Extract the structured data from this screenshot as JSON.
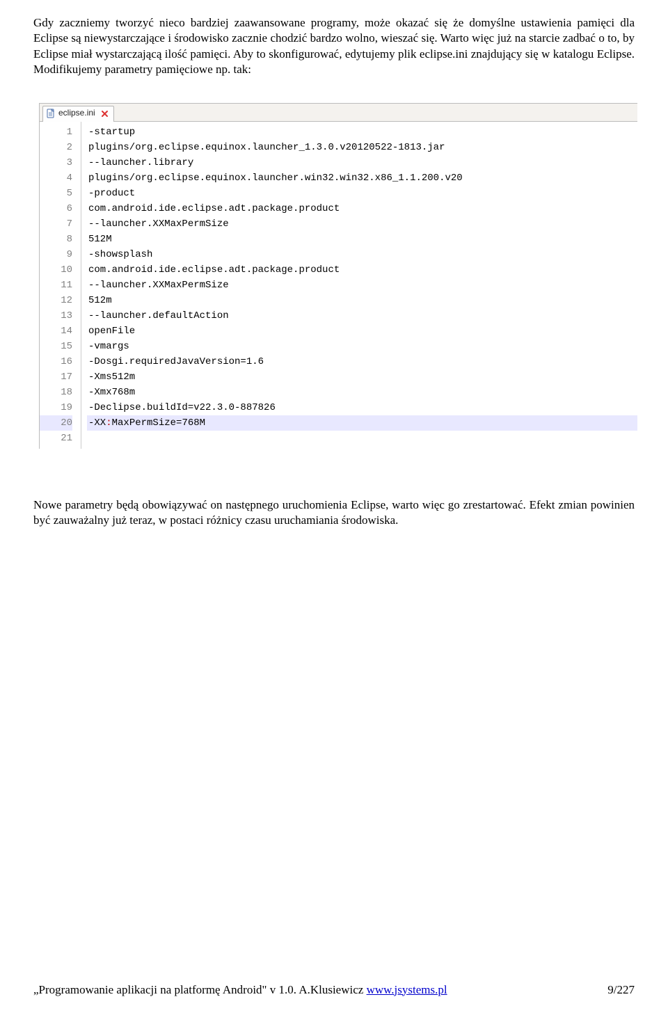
{
  "para1": "Gdy zaczniemy tworzyć nieco bardziej zaawansowane programy, może okazać się że domyślne ustawienia pamięci dla Eclipse są niewystarczające i środowisko zacznie chodzić bardzo wolno, wieszać się. Warto więc już na starcie zadbać o to, by Eclipse miał wystarczającą ilość pamięci. Aby to skonfigurować, edytujemy plik eclipse.ini znajdujący się w katalogu Eclipse. Modifikujemy parametry pamięciowe np. tak:",
  "editor": {
    "tab": {
      "filename": "eclipse.ini",
      "icon": "file-icon",
      "close": "close-icon"
    },
    "currentLine": 20,
    "lines": [
      {
        "n": 1,
        "text": "-startup"
      },
      {
        "n": 2,
        "text": "plugins/org.eclipse.equinox.launcher_1.3.0.v20120522-1813.jar"
      },
      {
        "n": 3,
        "text": "--launcher.library"
      },
      {
        "n": 4,
        "text": "plugins/org.eclipse.equinox.launcher.win32.win32.x86_1.1.200.v20"
      },
      {
        "n": 5,
        "text": "-product"
      },
      {
        "n": 6,
        "text": "com.android.ide.eclipse.adt.package.product"
      },
      {
        "n": 7,
        "text": "--launcher.XXMaxPermSize"
      },
      {
        "n": 8,
        "text": "512M"
      },
      {
        "n": 9,
        "text": "-showsplash"
      },
      {
        "n": 10,
        "text": "com.android.ide.eclipse.adt.package.product"
      },
      {
        "n": 11,
        "text": "--launcher.XXMaxPermSize"
      },
      {
        "n": 12,
        "text": "512m"
      },
      {
        "n": 13,
        "text": "--launcher.defaultAction"
      },
      {
        "n": 14,
        "text": "openFile"
      },
      {
        "n": 15,
        "text": "-vmargs"
      },
      {
        "n": 16,
        "text": "-Dosgi.requiredJavaVersion=1.6"
      },
      {
        "n": 17,
        "text": "-Xms512m"
      },
      {
        "n": 18,
        "text": "-Xmx768m"
      },
      {
        "n": 19,
        "text": "-Declipse.buildId=v22.3.0-887826"
      },
      {
        "n": 20,
        "text": "-XX:MaxPermSize=768M",
        "hl": "colon4"
      },
      {
        "n": 21,
        "text": ""
      }
    ]
  },
  "para2": "Nowe parametry będą obowiązywać on następnego uruchomienia Eclipse, warto więc go zrestartować. Efekt zmian powinien być zauważalny już teraz, w postaci różnicy czasu uruchamiania środowiska.",
  "footer": {
    "left_prefix": "„Programowanie aplikacji na platformę Android\" v 1.0. A.Klusiewicz ",
    "link": "www.jsystems.pl",
    "right": "9/227"
  }
}
